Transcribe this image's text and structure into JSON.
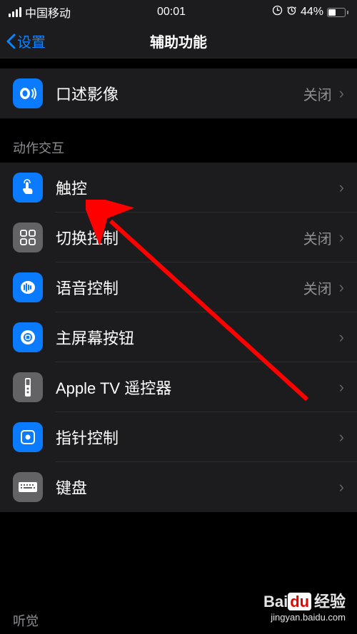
{
  "statusBar": {
    "carrier": "中国移动",
    "time": "00:01",
    "batteryPercent": "44%"
  },
  "nav": {
    "back": "设置",
    "title": "辅助功能"
  },
  "valueOff": "关闭",
  "group1": {
    "items": [
      {
        "label": "口述影像",
        "value": "关闭",
        "iconName": "audio-description-icon",
        "iconClass": "icon-blue"
      }
    ]
  },
  "group2": {
    "header": "动作交互",
    "items": [
      {
        "label": "触控",
        "value": "",
        "iconName": "touch-icon",
        "iconClass": "icon-blue"
      },
      {
        "label": "切换控制",
        "value": "关闭",
        "iconName": "switch-control-icon",
        "iconClass": "icon-gray"
      },
      {
        "label": "语音控制",
        "value": "关闭",
        "iconName": "voice-control-icon",
        "iconClass": "icon-blue"
      },
      {
        "label": "主屏幕按钮",
        "value": "",
        "iconName": "home-button-icon",
        "iconClass": "icon-blue"
      },
      {
        "label": "Apple TV 遥控器",
        "value": "",
        "iconName": "apple-tv-remote-icon",
        "iconClass": "icon-gray"
      },
      {
        "label": "指针控制",
        "value": "",
        "iconName": "pointer-control-icon",
        "iconClass": "icon-blue"
      },
      {
        "label": "键盘",
        "value": "",
        "iconName": "keyboard-icon",
        "iconClass": "icon-gray"
      }
    ]
  },
  "group3": {
    "header": "听觉"
  },
  "watermark": {
    "brand": "Bai",
    "brandBox": "du",
    "brandSuffix": "经验",
    "url": "jingyan.baidu.com"
  }
}
